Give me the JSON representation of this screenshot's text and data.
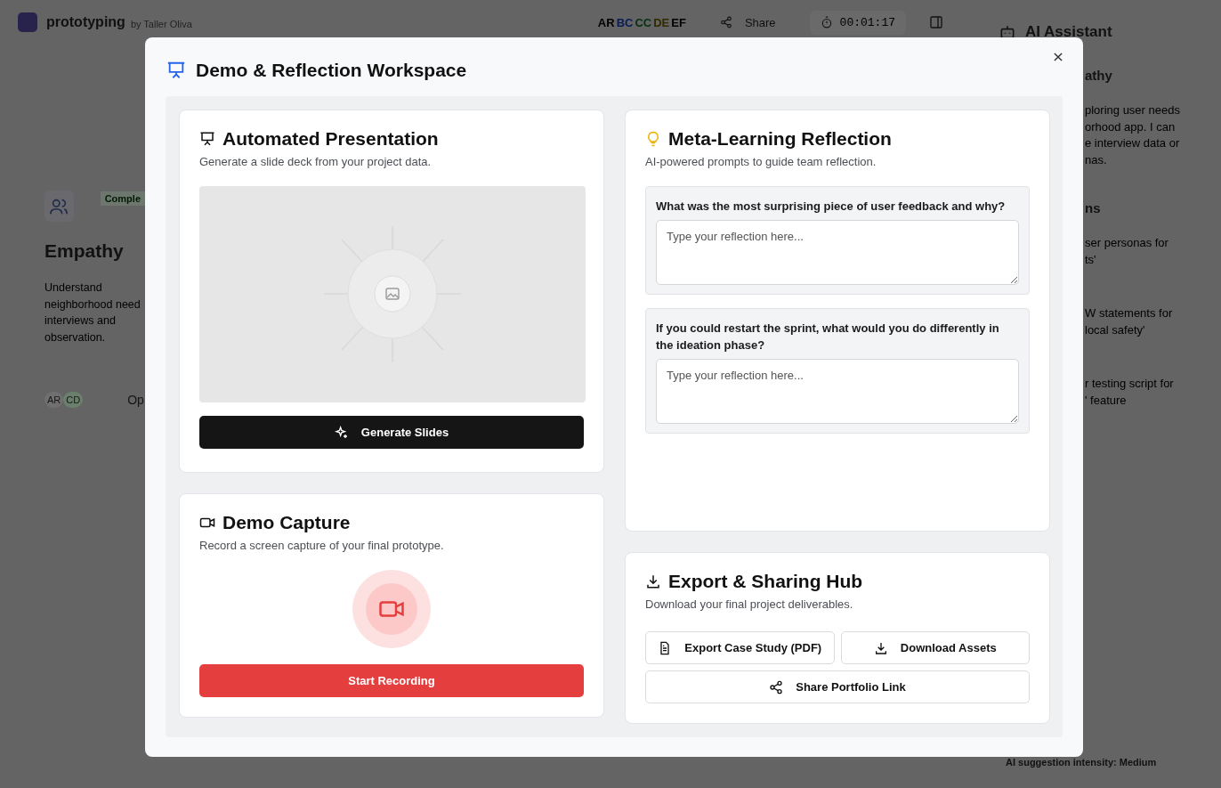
{
  "app": {
    "name": "prototyping",
    "author": "by Taller Oliva"
  },
  "collaborators": [
    {
      "initials": "AR",
      "color": "#000000"
    },
    {
      "initials": "BC",
      "color": "#0a1d55"
    },
    {
      "initials": "CC",
      "color": "#06300f"
    },
    {
      "initials": "DE",
      "color": "#302a00"
    },
    {
      "initials": "EF",
      "color": "#000000"
    }
  ],
  "share_label": "Share",
  "timer": "00:01:17",
  "phase_card": {
    "status": "Comple",
    "title": "Empathy",
    "description_lines": [
      "Understand",
      "neighborhood need",
      "interviews and",
      "observation."
    ],
    "avatars": [
      {
        "initials": "AR",
        "color": "#707070"
      },
      {
        "initials": "CD",
        "color": "#6a7f6c"
      }
    ],
    "action": "Op"
  },
  "assistant": {
    "title": "AI Assistant",
    "phase": "athy",
    "message_lines": [
      "ploring user needs",
      "orhood app. I can",
      "e interview data or",
      "nas."
    ],
    "section": "ns",
    "suggestions": [
      {
        "lines": [
          "ser personas for",
          "ts'"
        ]
      },
      {
        "lines": [
          "W statements for",
          "local safety'"
        ]
      },
      {
        "lines": [
          "r testing script for",
          "' feature"
        ]
      }
    ],
    "intensity": "AI suggestion intensity: Medium"
  },
  "modal": {
    "title": "Demo & Reflection Workspace",
    "presentation": {
      "title": "Automated Presentation",
      "subtitle": "Generate a slide deck from your project data.",
      "button": "Generate Slides"
    },
    "demo": {
      "title": "Demo Capture",
      "subtitle": "Record a screen capture of your final prototype.",
      "button": "Start Recording"
    },
    "reflection": {
      "title": "Meta-Learning Reflection",
      "subtitle": "AI-powered prompts to guide team reflection.",
      "prompts": [
        {
          "question": "What was the most surprising piece of user feedback and why?",
          "placeholder": "Type your reflection here..."
        },
        {
          "question": "If you could restart the sprint, what would you do differently in the ideation phase?",
          "placeholder": "Type your reflection here..."
        }
      ]
    },
    "export": {
      "title": "Export & Sharing Hub",
      "subtitle": "Download your final project deliverables.",
      "buttons": [
        {
          "label": "Export Case Study (PDF)",
          "kind": "document"
        },
        {
          "label": "Download Assets",
          "kind": "download"
        },
        {
          "label": "Share Portfolio Link",
          "kind": "share"
        }
      ]
    }
  }
}
